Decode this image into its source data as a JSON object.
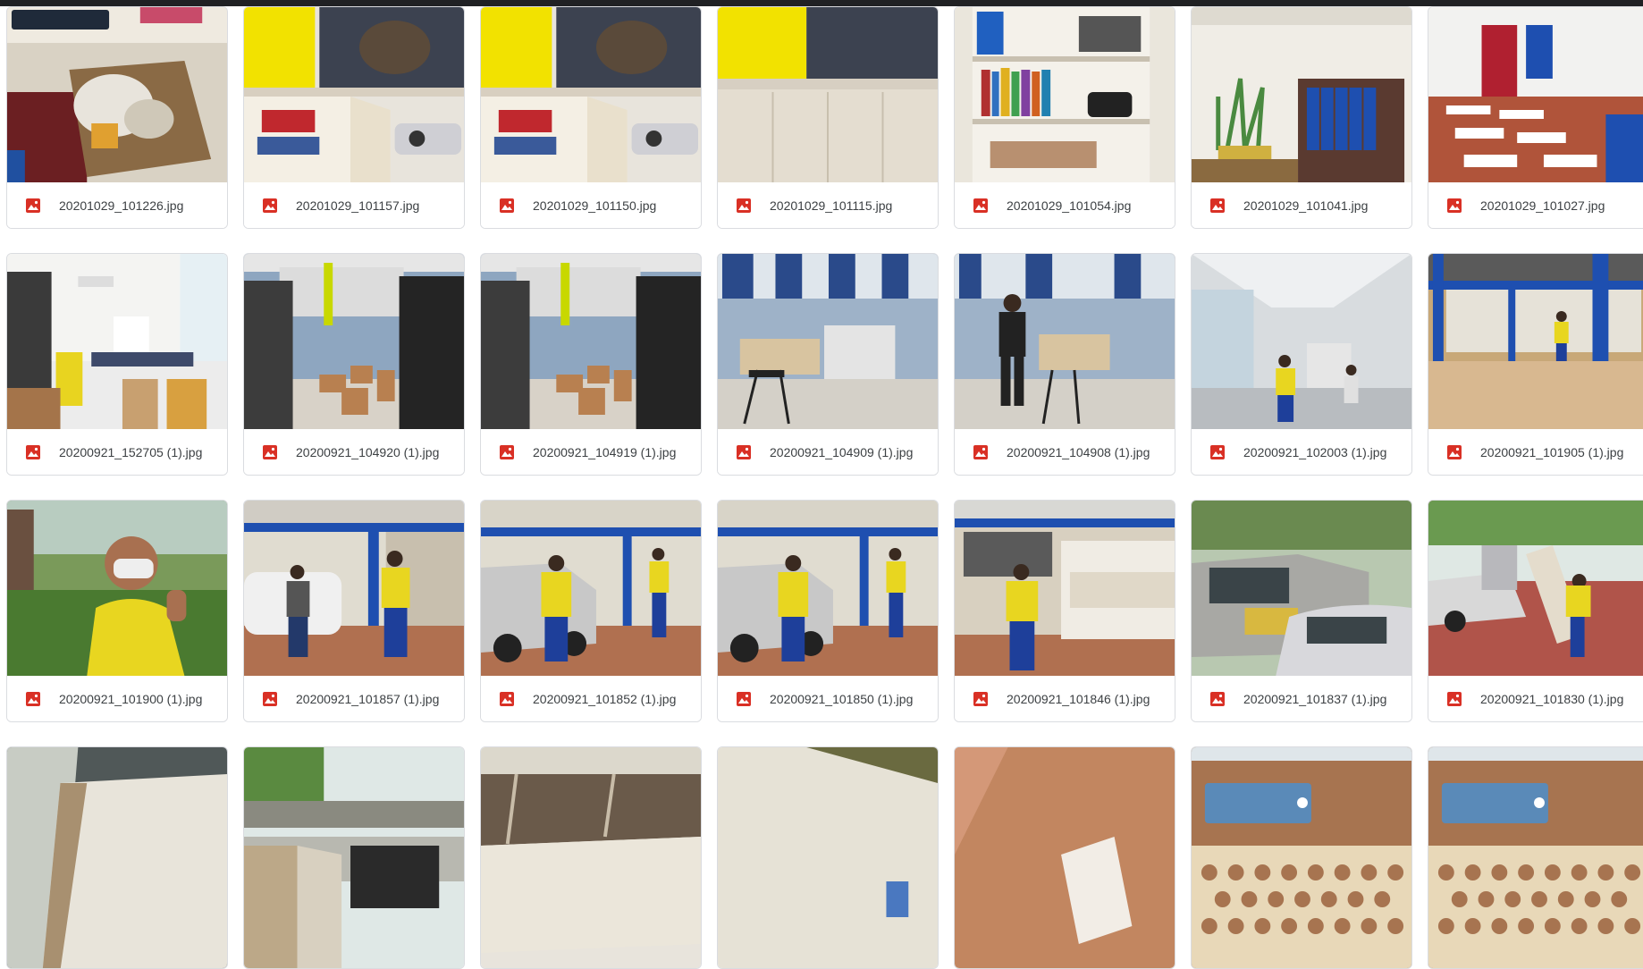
{
  "accent": "#d93025",
  "files": [
    {
      "name": "20201029_101226.jpg",
      "scene": "drawer"
    },
    {
      "name": "20201029_101157.jpg",
      "scene": "cabinet-yellow"
    },
    {
      "name": "20201029_101150.jpg",
      "scene": "cabinet-yellow"
    },
    {
      "name": "20201029_101115.jpg",
      "scene": "cupboard"
    },
    {
      "name": "20201029_101054.jpg",
      "scene": "shelf"
    },
    {
      "name": "20201029_101041.jpg",
      "scene": "binders"
    },
    {
      "name": "20201029_101027.jpg",
      "scene": "classroom"
    },
    {
      "name": "20200921_152705 (1).jpg",
      "scene": "office"
    },
    {
      "name": "20200921_104920 (1).jpg",
      "scene": "empty-room"
    },
    {
      "name": "20200921_104919 (1).jpg",
      "scene": "empty-room"
    },
    {
      "name": "20200921_104909 (1).jpg",
      "scene": "kitchen"
    },
    {
      "name": "20200921_104908 (1).jpg",
      "scene": "kitchen-man"
    },
    {
      "name": "20200921_102003 (1).jpg",
      "scene": "corridor"
    },
    {
      "name": "20200921_101905 (1).jpg",
      "scene": "porch"
    },
    {
      "name": "20200921_101900 (1).jpg",
      "scene": "man-thumbs"
    },
    {
      "name": "20200921_101857 (1).jpg",
      "scene": "building-workers"
    },
    {
      "name": "20200921_101852 (1).jpg",
      "scene": "truck-workers"
    },
    {
      "name": "20200921_101850 (1).jpg",
      "scene": "truck-workers"
    },
    {
      "name": "20200921_101846 (1).jpg",
      "scene": "loading"
    },
    {
      "name": "20200921_101837 (1).jpg",
      "scene": "truck"
    },
    {
      "name": "20200921_101830 (1).jpg",
      "scene": "truck-carry"
    },
    {
      "name": "",
      "scene": "panel-car"
    },
    {
      "name": "",
      "scene": "truck-cabinet"
    },
    {
      "name": "",
      "scene": "shelf-closeup"
    },
    {
      "name": "",
      "scene": "board"
    },
    {
      "name": "",
      "scene": "wood-label"
    },
    {
      "name": "",
      "scene": "chair-plate"
    },
    {
      "name": "",
      "scene": "chair-plate"
    }
  ]
}
